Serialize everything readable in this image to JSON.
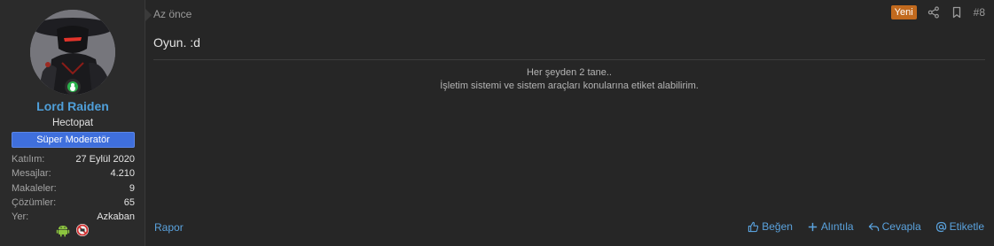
{
  "user": {
    "name": "Lord Raiden",
    "title": "Hectopat",
    "banner": "Süper Moderatör",
    "stats": [
      {
        "label": "Katılım:",
        "value": "27 Eylül 2020"
      },
      {
        "label": "Mesajlar:",
        "value": "4.210"
      },
      {
        "label": "Makaleler:",
        "value": "9"
      },
      {
        "label": "Çözümler:",
        "value": "65"
      },
      {
        "label": "Yer:",
        "value": "Azkaban"
      }
    ],
    "icons": [
      "android-icon",
      "no-entry-icon"
    ]
  },
  "post": {
    "time": "Az önce",
    "new_badge": "Yeni",
    "number": "#8",
    "message": "Oyun. :d",
    "signature_line1": "Her şeyden 2 tane..",
    "signature_line2": "İşletim sistemi ve sistem araçları konularına etiket alabilirim."
  },
  "footer": {
    "report": "Rapor",
    "like": "Beğen",
    "quote": "Alıntıla",
    "reply": "Cevapla",
    "tag": "Etiketle"
  },
  "colors": {
    "background": "#262626",
    "sidebar": "#2b2b2b",
    "username": "#4f9fd9",
    "banner": "#3f6fdc",
    "new_badge": "#c26a1e",
    "link": "#5aa2dd",
    "online": "#2bb24c"
  }
}
